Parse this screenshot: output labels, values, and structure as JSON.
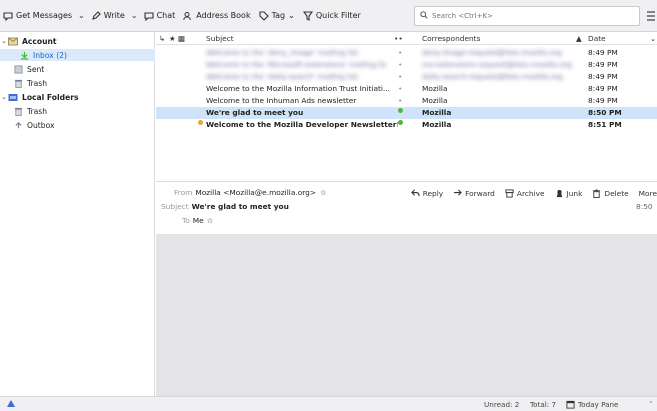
{
  "toolbar": {
    "get_messages": "Get Messages",
    "write": "Write",
    "chat": "Chat",
    "address_book": "Address Book",
    "tag": "Tag",
    "quick_filter": "Quick Filter",
    "search_placeholder": "Search <Ctrl+K>"
  },
  "folders": {
    "account": "Account",
    "inbox": "Inbox (2)",
    "sent": "Sent",
    "trash": "Trash",
    "local_folders": "Local Folders",
    "local_trash": "Trash",
    "outbox": "Outbox"
  },
  "thread_columns": {
    "subject": "Subject",
    "correspondents": "Correspondents",
    "date": "Date"
  },
  "threads": [
    {
      "subject": "Welcome to the 'deny_image' mailing list",
      "from": "deny-image-request@lists.mozilla.org",
      "date": "8:49 PM"
    },
    {
      "subject": "Welcome to the 'Microsoft-extensions' mailing list",
      "from": "ms-extensions-request@lists.mozilla.org",
      "date": "8:49 PM"
    },
    {
      "subject": "Welcome to the 'daily-search' mailing list",
      "from": "daily-search-request@lists.mozilla.org",
      "date": "8:49 PM"
    },
    {
      "subject": "Welcome to the Mozilla Information Trust Initiati...",
      "from": "Mozilla",
      "date": "8:49 PM"
    },
    {
      "subject": "Welcome to the Inhuman Ads newsletter",
      "from": "Mozilla",
      "date": "8:49 PM"
    },
    {
      "subject": "We're glad to meet you",
      "from": "Mozilla",
      "date": "8:50 PM"
    },
    {
      "subject": "Welcome to the Mozilla Developer Newsletter!",
      "from": "Mozilla",
      "date": "8:51 PM"
    }
  ],
  "message": {
    "from_label": "From",
    "from": "Mozilla <Mozilla@e.mozilla.org>",
    "subject_label": "Subject",
    "subject": "We're glad to meet you",
    "to_label": "To",
    "to": "Me",
    "time": "8:50",
    "reply": "Reply",
    "forward": "Forward",
    "archive": "Archive",
    "junk": "Junk",
    "delete": "Delete",
    "more": "More"
  },
  "status": {
    "unread": "Unread: 2",
    "total": "Total: 7",
    "today_pane": "Today Pane"
  },
  "colors": {
    "accent": "#1a65c8",
    "selected_row": "#cfe3fa",
    "unread_dot": "#4fb63c",
    "new_dot": "#f0a23a"
  }
}
